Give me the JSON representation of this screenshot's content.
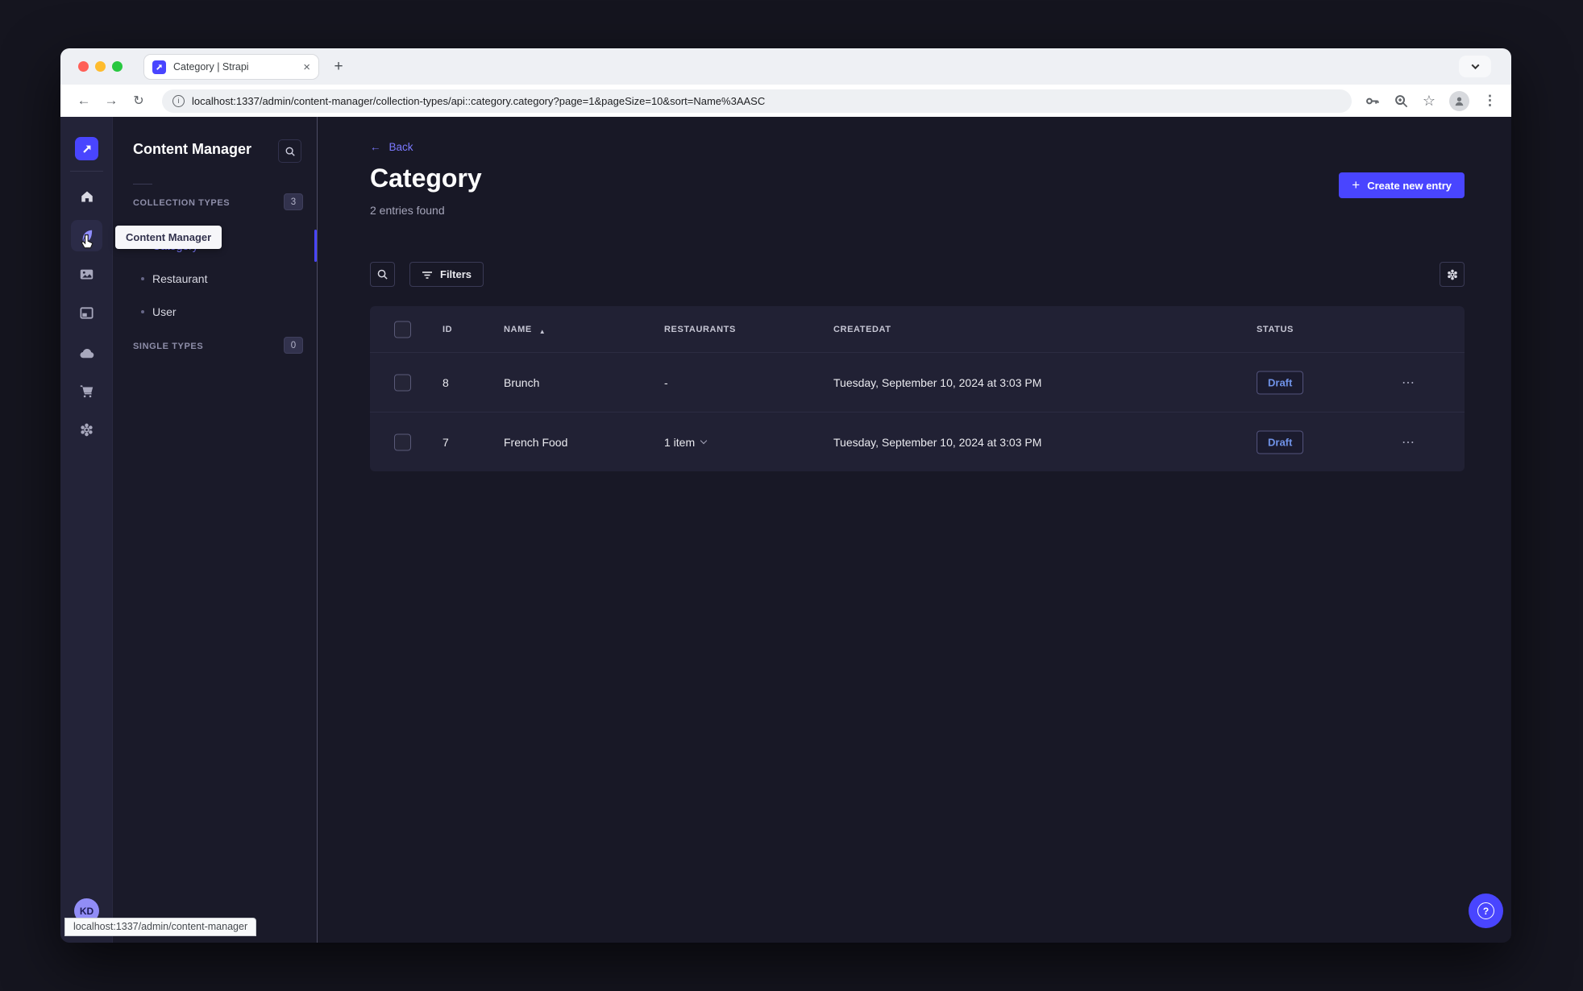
{
  "browser": {
    "tab_title": "Category | Strapi",
    "url": "localhost:1337/admin/content-manager/collection-types/api::category.category?page=1&pageSize=10&sort=Name%3AASC",
    "status_bar_url": "localhost:1337/admin/content-manager"
  },
  "colors": {
    "accent": "#4945ff",
    "link": "#7b79ff",
    "draft_text": "#7093e8",
    "page_bg": "#181826",
    "panel_bg": "#212134"
  },
  "nav": {
    "tooltip": "Content Manager",
    "avatar_initials": "KD"
  },
  "subnav": {
    "title": "Content Manager",
    "sections": [
      {
        "label": "COLLECTION TYPES",
        "badge": "3",
        "items": [
          {
            "label": "Category"
          },
          {
            "label": "Restaurant"
          },
          {
            "label": "User"
          }
        ]
      },
      {
        "label": "SINGLE TYPES",
        "badge": "0",
        "items": []
      }
    ]
  },
  "main": {
    "back_label": "Back",
    "title": "Category",
    "subtitle": "2 entries found",
    "create_button": "Create new entry",
    "filters_button": "Filters",
    "table": {
      "headers": {
        "id": "ID",
        "name": "NAME",
        "restaurants": "RESTAURANTS",
        "createdat": "CREATEDAT",
        "status": "STATUS"
      },
      "rows": [
        {
          "id": "8",
          "name": "Brunch",
          "restaurants": "-",
          "createdat": "Tuesday, September 10, 2024 at 3:03 PM",
          "status": "Draft"
        },
        {
          "id": "7",
          "name": "French Food",
          "restaurants": "1 item",
          "createdat": "Tuesday, September 10, 2024 at 3:03 PM",
          "status": "Draft"
        }
      ]
    }
  }
}
